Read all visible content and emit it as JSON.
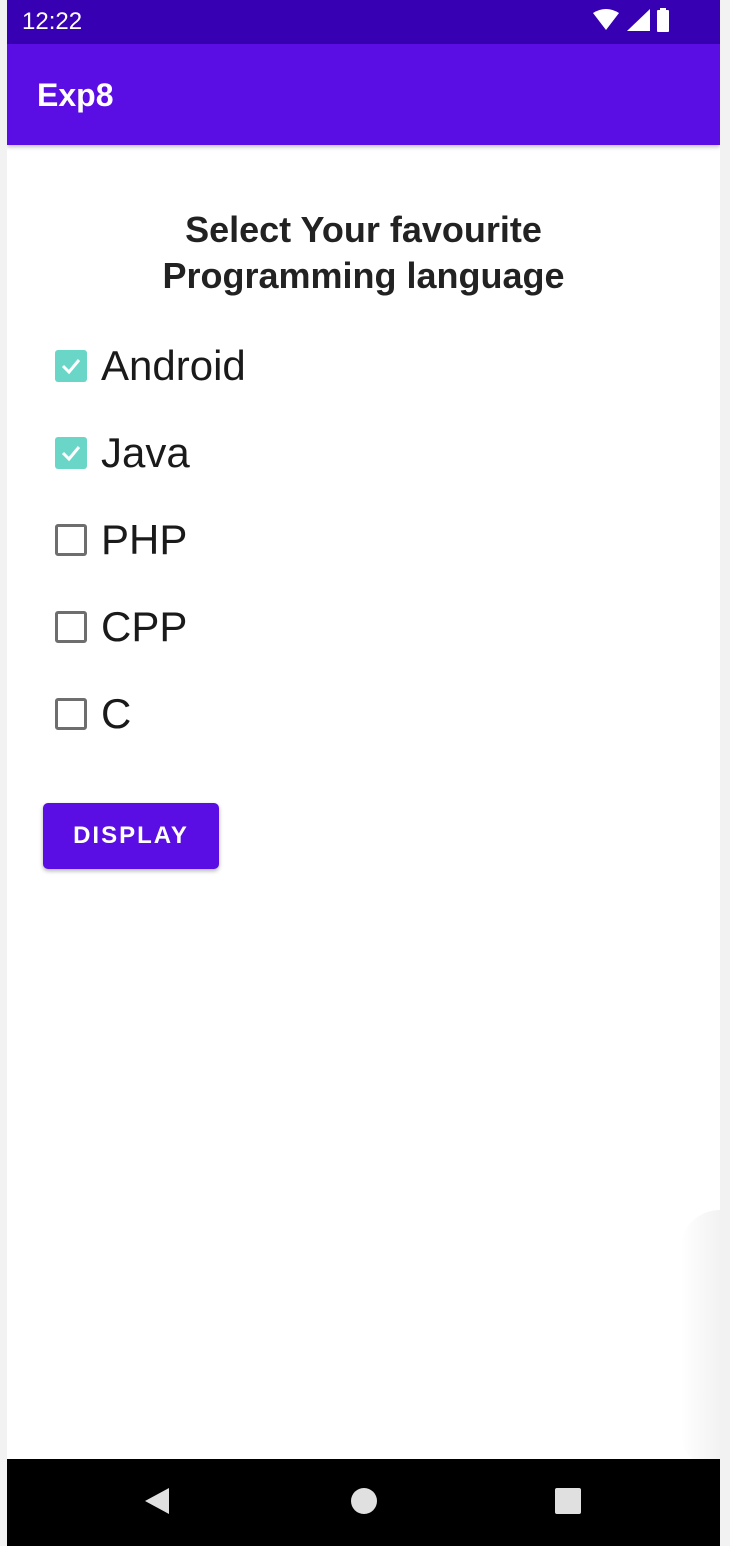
{
  "status_bar": {
    "time": "12:22",
    "icons": [
      "wifi-icon",
      "cellular-signal-icon",
      "battery-icon"
    ]
  },
  "app_bar": {
    "title": "Exp8",
    "color": "#5a0ee4"
  },
  "heading": {
    "line1": "Select Your favourite",
    "line2": "Programming language"
  },
  "options": [
    {
      "label": "Android",
      "checked": true
    },
    {
      "label": "Java",
      "checked": true
    },
    {
      "label": "PHP",
      "checked": false
    },
    {
      "label": "CPP",
      "checked": false
    },
    {
      "label": "C",
      "checked": false
    }
  ],
  "button": {
    "label": "DISPLAY"
  },
  "nav_bar": {
    "buttons": [
      "back-icon",
      "home-icon",
      "recents-icon"
    ]
  },
  "colors": {
    "status_bar": "#3700b3",
    "primary": "#5a0ee4",
    "checkbox_checked": "#6ad6c8"
  }
}
